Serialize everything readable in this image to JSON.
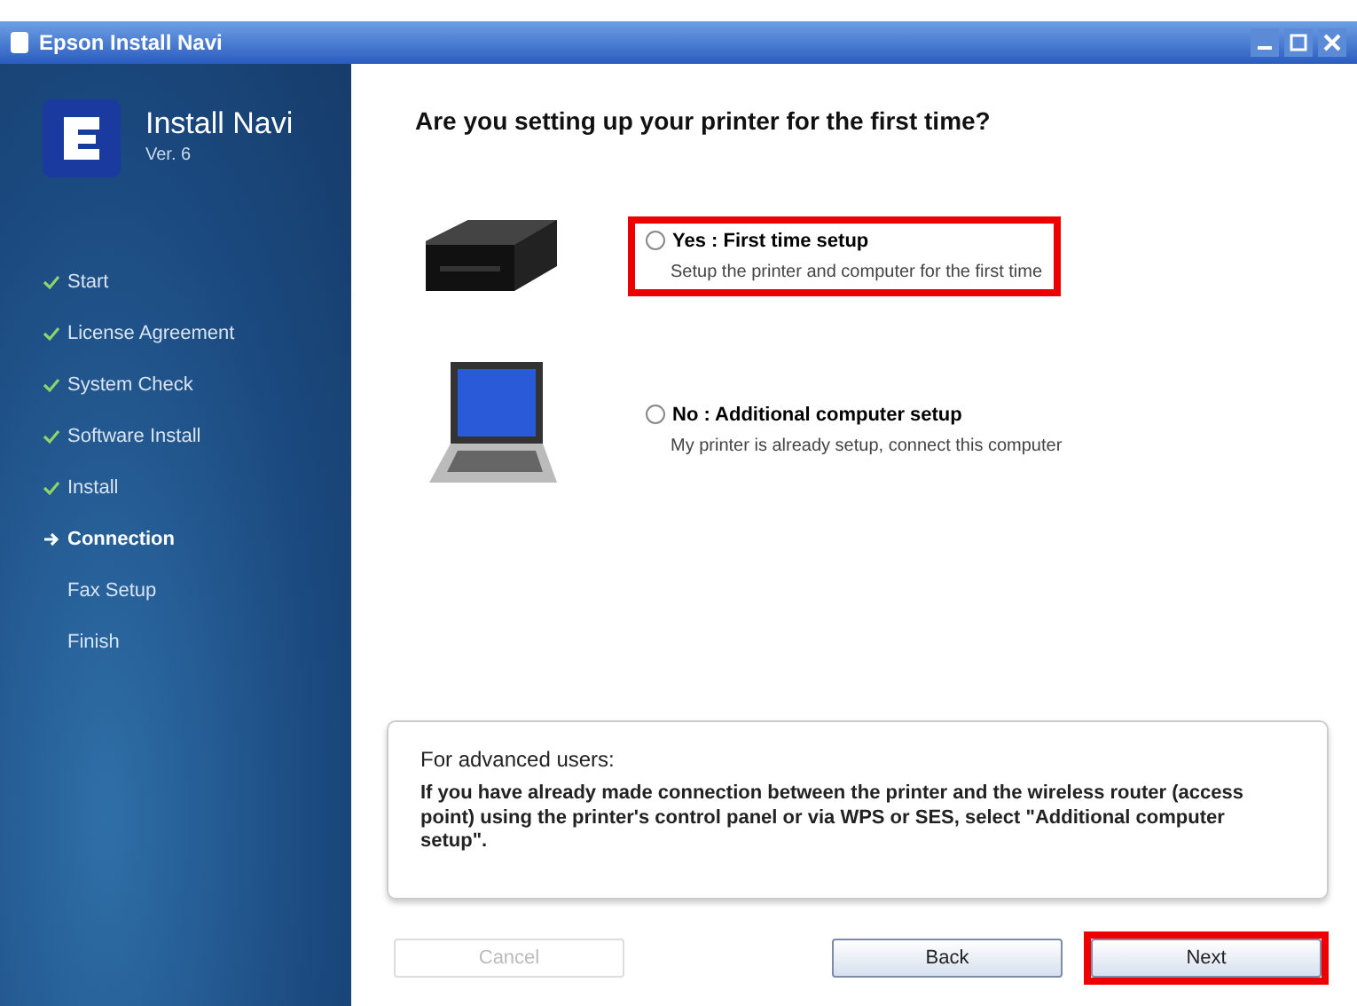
{
  "window": {
    "title": "Epson Install Navi"
  },
  "sidebar": {
    "app_name": "Install Navi",
    "version": "Ver. 6",
    "steps": [
      {
        "label": "Start",
        "done": true,
        "current": false
      },
      {
        "label": "License Agreement",
        "done": true,
        "current": false
      },
      {
        "label": "System Check",
        "done": true,
        "current": false
      },
      {
        "label": "Software Install",
        "done": true,
        "current": false
      },
      {
        "label": "Install",
        "done": true,
        "current": false
      },
      {
        "label": "Connection",
        "done": false,
        "current": true
      },
      {
        "label": "Fax Setup",
        "done": false,
        "current": false
      },
      {
        "label": "Finish",
        "done": false,
        "current": false
      }
    ]
  },
  "question": "Are you setting up your printer for the first time?",
  "options": [
    {
      "kind": "printer",
      "title": "Yes : First time setup",
      "description": "Setup the printer and computer for the first time",
      "selected": false,
      "highlighted": true
    },
    {
      "kind": "laptop",
      "title": "No : Additional computer setup",
      "description": "My printer is already setup, connect this computer",
      "selected": false,
      "highlighted": false
    }
  ],
  "advanced": {
    "heading": "For advanced users:",
    "text": "If you have already made connection between the printer and the wireless router (access point) using the printer's control panel or via WPS or SES, select \"Additional computer setup\"."
  },
  "buttons": [
    {
      "label": "Cancel",
      "disabled": true,
      "highlighted": false
    },
    {
      "label": "Back",
      "disabled": false,
      "highlighted": false
    },
    {
      "label": "Next",
      "disabled": false,
      "highlighted": true
    }
  ]
}
